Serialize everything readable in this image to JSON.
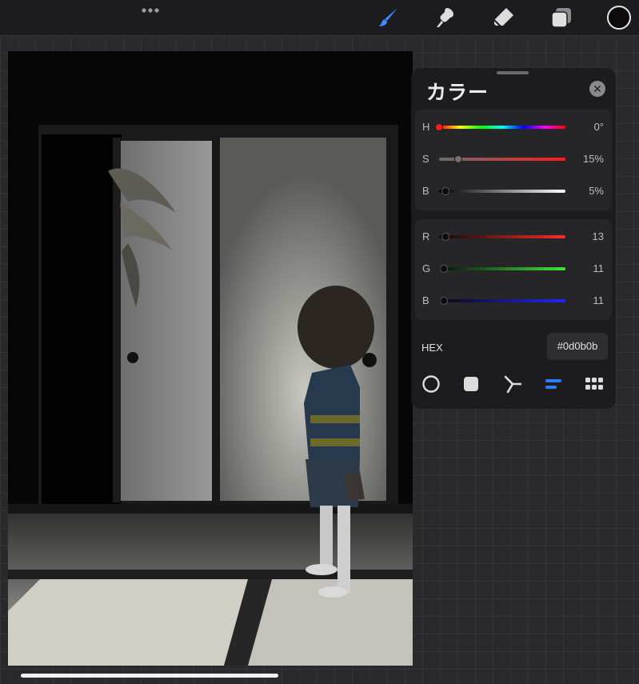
{
  "panel": {
    "title": "カラー",
    "close_glyph": "✕",
    "hsb": [
      {
        "label": "H",
        "value": "0°",
        "level": 0.0,
        "knob_color": "#ff1a1a"
      },
      {
        "label": "S",
        "value": "15%",
        "level": 0.15,
        "knob_color": "#7a6c6c"
      },
      {
        "label": "B",
        "value": "5%",
        "level": 0.05,
        "knob_color": "#0d0b0b"
      }
    ],
    "rgb": [
      {
        "label": "R",
        "value": "13",
        "level": 0.05,
        "knob_color": "#0d0b0b"
      },
      {
        "label": "G",
        "value": "11",
        "level": 0.04,
        "knob_color": "#0d0b0b"
      },
      {
        "label": "B",
        "value": "11",
        "level": 0.04,
        "knob_color": "#0d0b0b"
      }
    ],
    "hex_label": "HEX",
    "hex_value": "#0d0b0b",
    "modes": [
      "disc-mode-icon",
      "classic-mode-icon",
      "harmony-mode-icon",
      "value-mode-icon",
      "palettes-mode-icon"
    ],
    "active_mode": "value-mode-icon"
  },
  "toolbar": {
    "tools": [
      "brush-icon",
      "smudge-icon",
      "eraser-icon",
      "layers-icon"
    ],
    "active_tool": "brush-icon",
    "current_color": "#0d0b0b"
  },
  "colors": {
    "accent": "#2f7ef5",
    "panel_bg": "#1c1c1e"
  }
}
